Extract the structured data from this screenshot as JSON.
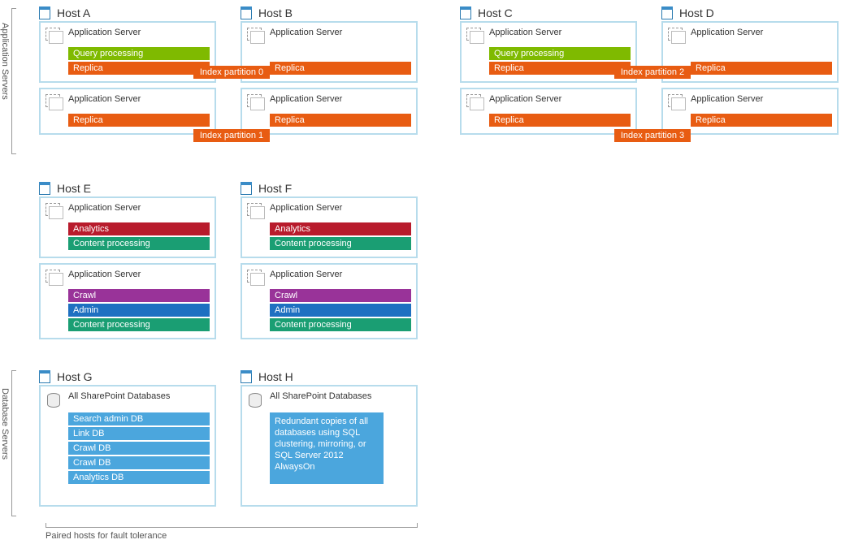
{
  "sections": {
    "appServers": "Application Servers",
    "dbServers": "Database Servers"
  },
  "appServerLabel": "Application Server",
  "dbLabel": "All SharePoint Databases",
  "hosts": {
    "A": {
      "title": "Host A",
      "rows": [
        [
          "Query processing",
          "Replica"
        ],
        [
          "Replica"
        ]
      ]
    },
    "B": {
      "title": "Host B",
      "rows": [
        [
          "Replica"
        ],
        [
          "Replica"
        ]
      ]
    },
    "C": {
      "title": "Host C",
      "rows": [
        [
          "Query processing",
          "Replica"
        ],
        [
          "Replica"
        ]
      ]
    },
    "D": {
      "title": "Host D",
      "rows": [
        [
          "Replica"
        ],
        [
          "Replica"
        ]
      ]
    },
    "E": {
      "title": "Host E",
      "rows": [
        [
          "Analytics",
          "Content processing"
        ],
        [
          "Crawl",
          "Admin",
          "Content processing"
        ]
      ]
    },
    "F": {
      "title": "Host F",
      "rows": [
        [
          "Analytics",
          "Content processing"
        ],
        [
          "Crawl",
          "Admin",
          "Content processing"
        ]
      ]
    },
    "G": {
      "title": "Host G",
      "dbs": [
        "Search admin DB",
        "Link DB",
        "Crawl DB",
        "Crawl DB",
        "Analytics DB"
      ]
    },
    "H": {
      "title": "Host H",
      "note": "Redundant copies of all databases using SQL clustering, mirroring, or SQL Server 2012 AlwaysOn"
    }
  },
  "indexPartitions": [
    "Index partition 0",
    "Index partition 1",
    "Index partition 2",
    "Index partition 3"
  ],
  "footer": "Paired hosts for fault tolerance",
  "chipLabels": {
    "query": "Query processing",
    "replica": "Replica",
    "analytics": "Analytics",
    "content": "Content processing",
    "crawl": "Crawl",
    "admin": "Admin"
  }
}
